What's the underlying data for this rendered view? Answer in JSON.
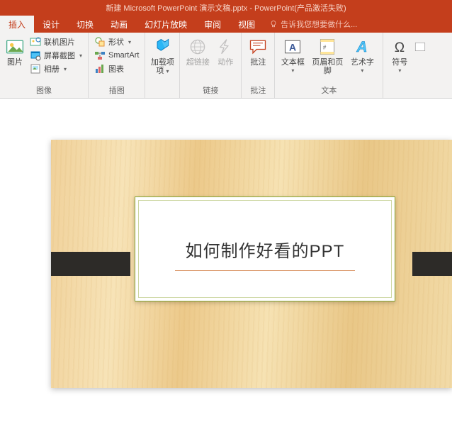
{
  "title": "新建 Microsoft PowerPoint 演示文稿.pptx - PowerPoint(产品激活失败)",
  "tabs": {
    "insert": "插入",
    "design": "设计",
    "transitions": "切换",
    "animations": "动画",
    "slideshow": "幻灯片放映",
    "review": "审阅",
    "view": "视图"
  },
  "tell_me": "告诉我您想要做什么...",
  "ribbon": {
    "images": {
      "pictures": "图片",
      "online_pictures": "联机图片",
      "screenshot": "屏幕截图",
      "photo_album": "相册",
      "group": "图像"
    },
    "illustrations": {
      "shapes": "形状",
      "smartart": "SmartArt",
      "chart": "图表",
      "group": "插图"
    },
    "addins": {
      "addins": "加载项",
      "dropdown": ""
    },
    "links": {
      "hyperlink": "超链接",
      "action": "动作",
      "group": "链接"
    },
    "comments": {
      "comment": "批注",
      "group": "批注"
    },
    "text": {
      "textbox": "文本框",
      "header_footer": "页眉和页脚",
      "wordart": "艺术字",
      "group": "文本"
    },
    "symbols": {
      "symbol": "符号",
      "group": ""
    }
  },
  "slide": {
    "title": "如何制作好看的PPT"
  }
}
